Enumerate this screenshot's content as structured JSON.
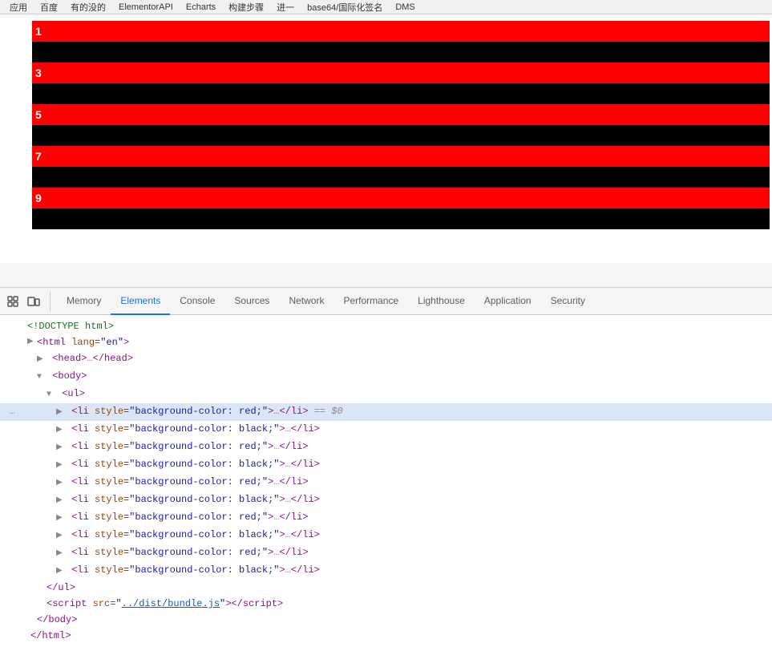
{
  "browser": {
    "tabs": [
      "应用",
      "百度",
      "有的没的",
      "ElementorAPI",
      "Echarts",
      "构建步骤",
      "进一",
      "base64/国际化签名",
      "DMS"
    ]
  },
  "page": {
    "list_items": [
      {
        "number": "1",
        "bg": "red"
      },
      {
        "number": "",
        "bg": "black"
      },
      {
        "number": "3",
        "bg": "red"
      },
      {
        "number": "",
        "bg": "black"
      },
      {
        "number": "5",
        "bg": "red"
      },
      {
        "number": "",
        "bg": "black"
      },
      {
        "number": "7",
        "bg": "red"
      },
      {
        "number": "",
        "bg": "black"
      },
      {
        "number": "9",
        "bg": "red"
      },
      {
        "number": "",
        "bg": "black"
      }
    ]
  },
  "devtools": {
    "icons": {
      "cursor_label": "⬚",
      "device_label": "▭"
    },
    "tabs": [
      "Memory",
      "Elements",
      "Console",
      "Sources",
      "Network",
      "Performance",
      "Lighthouse",
      "Application",
      "Security"
    ],
    "active_tab": "Elements"
  },
  "html_tree": {
    "doctype": "<!DOCTYPE html>",
    "html_open": "<html lang=\"en\">",
    "head": "<head>…</head>",
    "body_open": "<body>",
    "ul_open": "▼<ul>",
    "li_selected": "▶ <li style=\"background-color: red;\">…</li> == $0",
    "li_black_1": "▶ <li style=\"background-color: black;\">…</li>",
    "li_red_2": "▶ <li style=\"background-color: red;\">…</li>",
    "li_black_2": "▶ <li style=\"background-color: black;\">…</li>",
    "li_red_3": "▶ <li style=\"background-color: red;\">…</li>",
    "li_black_3": "▶ <li style=\"background-color: black;\">…</li>",
    "li_red_4": "▶ <li style=\"background-color: red;\">…</li>",
    "li_black_4": "▶ <li style=\"background-color: black;\">…</li>",
    "li_red_5": "▶ <li style=\"background-color: red;\">…</li>",
    "li_black_5": "▶ <li style=\"background-color: black;\">…</li>",
    "ul_close": "</ul>",
    "script_line": "<script src=\"../dist/bundle.js\"></script>",
    "body_close": "</body>",
    "html_close": "</html>"
  }
}
